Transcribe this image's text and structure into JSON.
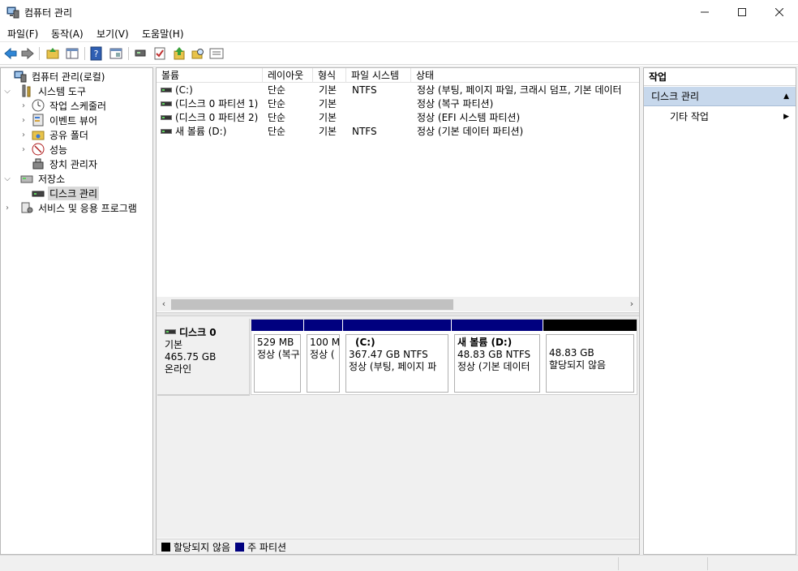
{
  "window": {
    "title": "컴퓨터 관리"
  },
  "menu": [
    "파일(F)",
    "동작(A)",
    "보기(V)",
    "도움말(H)"
  ],
  "tree": [
    {
      "label": "컴퓨터 관리(로컬)",
      "icon": "computer-icon",
      "level": 0,
      "expander": ""
    },
    {
      "label": "시스템 도구",
      "icon": "tools-icon",
      "level": 1,
      "expander": "expanded"
    },
    {
      "label": "작업 스케줄러",
      "icon": "clock-icon",
      "level": 2,
      "expander": "collapsed"
    },
    {
      "label": "이벤트 뷰어",
      "icon": "event-viewer-icon",
      "level": 2,
      "expander": "collapsed"
    },
    {
      "label": "공유 폴더",
      "icon": "shared-folder-icon",
      "level": 2,
      "expander": "collapsed"
    },
    {
      "label": "성능",
      "icon": "performance-icon",
      "level": 2,
      "expander": "collapsed"
    },
    {
      "label": "장치 관리자",
      "icon": "device-manager-icon",
      "level": 2,
      "expander": ""
    },
    {
      "label": "저장소",
      "icon": "storage-icon",
      "level": 1,
      "expander": "expanded"
    },
    {
      "label": "디스크 관리",
      "icon": "disk-icon",
      "level": 2,
      "expander": "",
      "selected": true
    },
    {
      "label": "서비스 및 응용 프로그램",
      "icon": "services-icon",
      "level": 1,
      "expander": "collapsed"
    }
  ],
  "volume_list": {
    "columns": [
      "볼륨",
      "레이아웃",
      "형식",
      "파일 시스템",
      "상태"
    ],
    "rows": [
      [
        "(C:)",
        "단순",
        "기본",
        "NTFS",
        "정상 (부팅, 페이지 파일, 크래시 덤프, 기본 데이터"
      ],
      [
        "(디스크 0 파티션 1)",
        "단순",
        "기본",
        "",
        "정상 (복구 파티션)"
      ],
      [
        "(디스크 0 파티션 2)",
        "단순",
        "기본",
        "",
        "정상 (EFI 시스템 파티션)"
      ],
      [
        "새 볼륨 (D:)",
        "단순",
        "기본",
        "NTFS",
        "정상 (기본 데이터 파티션)"
      ]
    ]
  },
  "disk": {
    "name": "디스크 0",
    "type": "기본",
    "size": "465.75 GB",
    "status": "온라인",
    "partitions": [
      {
        "name": "",
        "size": "529 MB",
        "status": "정상 (복구",
        "bar": "#00007f"
      },
      {
        "name": "",
        "size": "100 M",
        "status": "정상 (",
        "bar": "#00007f"
      },
      {
        "name": "(C:)",
        "size": "367.47 GB NTFS",
        "status": "정상 (부팅, 페이지 파",
        "bar": "#00007f"
      },
      {
        "name": "새 볼륨  (D:)",
        "size": "48.83 GB NTFS",
        "status": "정상 (기본 데이터",
        "bar": "#00007f"
      },
      {
        "name": "",
        "size": "48.83 GB",
        "status": "할당되지 않음",
        "bar": "#000000"
      }
    ]
  },
  "legend": [
    {
      "label": "할당되지 않음",
      "color": "#000000"
    },
    {
      "label": "주 파티션",
      "color": "#00007f"
    }
  ],
  "actions": {
    "header": "작업",
    "section": "디스크 관리",
    "item": "기타 작업"
  }
}
